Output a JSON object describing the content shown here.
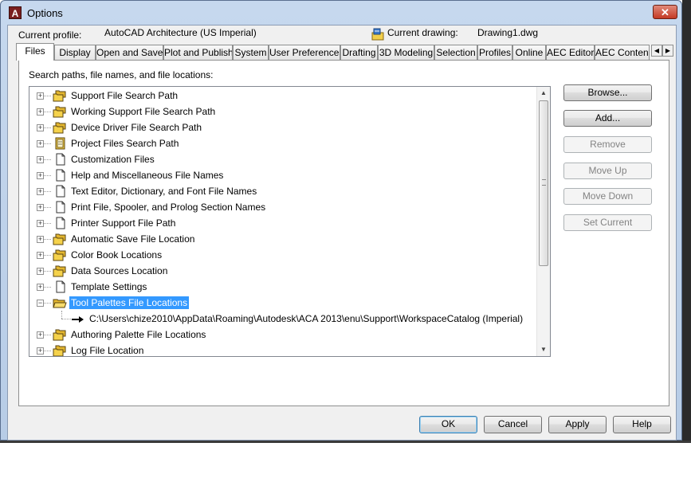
{
  "window": {
    "title": "Options",
    "app_icon_letter": "A",
    "close_glyph": "✕"
  },
  "header": {
    "profile_label": "Current profile:",
    "profile_value": "AutoCAD Architecture (US Imperial)",
    "drawing_label": "Current drawing:",
    "drawing_value": "Drawing1.dwg"
  },
  "tabs": [
    {
      "label": "Files",
      "active": true
    },
    {
      "label": "Display"
    },
    {
      "label": "Open and Save"
    },
    {
      "label": "Plot and Publish"
    },
    {
      "label": "System"
    },
    {
      "label": "User Preferences"
    },
    {
      "label": "Drafting"
    },
    {
      "label": "3D Modeling"
    },
    {
      "label": "Selection"
    },
    {
      "label": "Profiles"
    },
    {
      "label": "Online"
    },
    {
      "label": "AEC Editor"
    },
    {
      "label": "AEC Content"
    }
  ],
  "tab_scroll": {
    "left": "◀",
    "right": "▶"
  },
  "files": {
    "caption": "Search paths, file names, and file locations:",
    "tree": [
      {
        "label": "Support File Search Path",
        "icon": "folder-stack-icon",
        "expander": "+"
      },
      {
        "label": "Working Support File Search Path",
        "icon": "folder-stack-icon",
        "expander": "+"
      },
      {
        "label": "Device Driver File Search Path",
        "icon": "folder-stack-icon",
        "expander": "+"
      },
      {
        "label": "Project Files Search Path",
        "icon": "project-book-icon",
        "expander": "+"
      },
      {
        "label": "Customization Files",
        "icon": "document-icon",
        "expander": "+"
      },
      {
        "label": "Help and Miscellaneous File Names",
        "icon": "document-icon",
        "expander": "+"
      },
      {
        "label": "Text Editor, Dictionary, and Font File Names",
        "icon": "document-icon",
        "expander": "+"
      },
      {
        "label": "Print File, Spooler, and Prolog Section Names",
        "icon": "document-icon",
        "expander": "+"
      },
      {
        "label": "Printer Support File Path",
        "icon": "document-icon",
        "expander": "+"
      },
      {
        "label": "Automatic Save File Location",
        "icon": "folder-stack-icon",
        "expander": "+"
      },
      {
        "label": "Color Book Locations",
        "icon": "folder-stack-icon",
        "expander": "+"
      },
      {
        "label": "Data Sources Location",
        "icon": "folder-stack-icon",
        "expander": "+"
      },
      {
        "label": "Template Settings",
        "icon": "document-icon",
        "expander": "+"
      },
      {
        "label": "Tool Palettes File Locations",
        "icon": "folder-open-icon",
        "expander": "−",
        "selected": true
      },
      {
        "label": "C:\\Users\\chize2010\\AppData\\Roaming\\Autodesk\\ACA 2013\\enu\\Support\\WorkspaceCatalog (Imperial)",
        "child": true
      },
      {
        "label": "Authoring Palette File Locations",
        "icon": "folder-stack-icon",
        "expander": "+"
      },
      {
        "label": "Log File Location",
        "icon": "folder-stack-icon",
        "expander": "+"
      }
    ]
  },
  "side_buttons": [
    {
      "label": "Browse...",
      "enabled": true
    },
    {
      "label": "Add...",
      "enabled": true
    },
    {
      "label": "Remove",
      "enabled": false
    },
    {
      "label": "Move Up",
      "enabled": false
    },
    {
      "label": "Move Down",
      "enabled": false
    },
    {
      "label": "Set Current",
      "enabled": false
    }
  ],
  "footer_buttons": [
    {
      "label": "OK",
      "default": true
    },
    {
      "label": "Cancel"
    },
    {
      "label": "Apply"
    },
    {
      "label": "Help"
    }
  ],
  "scrollbar": {
    "up": "▲",
    "down": "▼",
    "position": 0.0
  }
}
